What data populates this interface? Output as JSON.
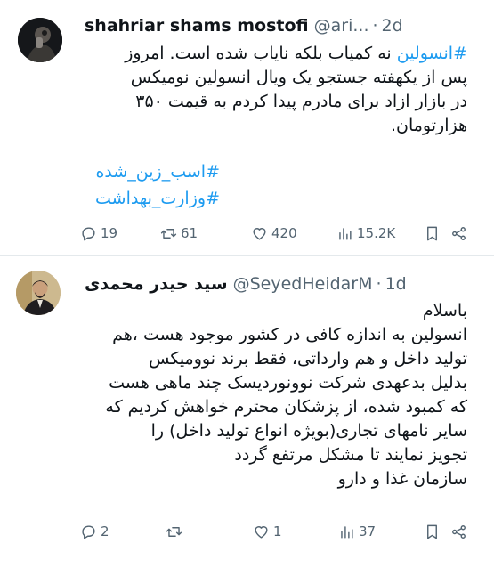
{
  "tweet1": {
    "name": "shahriar shams mostofi",
    "handle": "@ari...",
    "time": "2d",
    "hashtag_inline": "#انسولین",
    "line1_rest": " نه کمیاب بلکه نایاب شده است. امروز",
    "line2": "پس از یکهفته جستجو یک ویال انسولین نومیکس",
    "line3": "در بازار ازاد برای مادرم پیدا کردم به قیمت ۳۵۰",
    "line4": "هزارتومان.",
    "tag1": "#اسب_زین_شده",
    "tag2": "#وزارت_بهداشت",
    "replies": "19",
    "retweets": "61",
    "likes": "420",
    "views": "15.2K"
  },
  "tweet2": {
    "name": "سید حیدر محمدی",
    "handle": "@SeyedHeidarM",
    "time": "1d",
    "lines": [
      "باسلام",
      "انسولین به اندازه کافی در کشور موجود هست ،هم",
      "تولید داخل و هم وارداتی، فقط برند نوومیکس",
      "بدلیل بدعهدی شرکت نوونوردیسک چند ماهی هست",
      "که کمبود شده، از پزشکان محترم خواهش کردیم که",
      "سایر نامهای تجاری(بویژه انواع تولید داخل) را",
      "تجویز نمایند تا مشکل مرتفع گردد",
      "سازمان غذا و دارو"
    ],
    "replies": "2",
    "retweets": "",
    "likes": "1",
    "views": "37"
  },
  "icons": {
    "reply": "reply-icon",
    "retweet": "retweet-icon",
    "like": "heart-icon",
    "views": "views-icon",
    "bookmark": "bookmark-icon",
    "share": "share-icon"
  },
  "colors": {
    "hashtag": "#1d9bf0",
    "secondary_text": "#536471",
    "divider": "#e4e9ec"
  }
}
